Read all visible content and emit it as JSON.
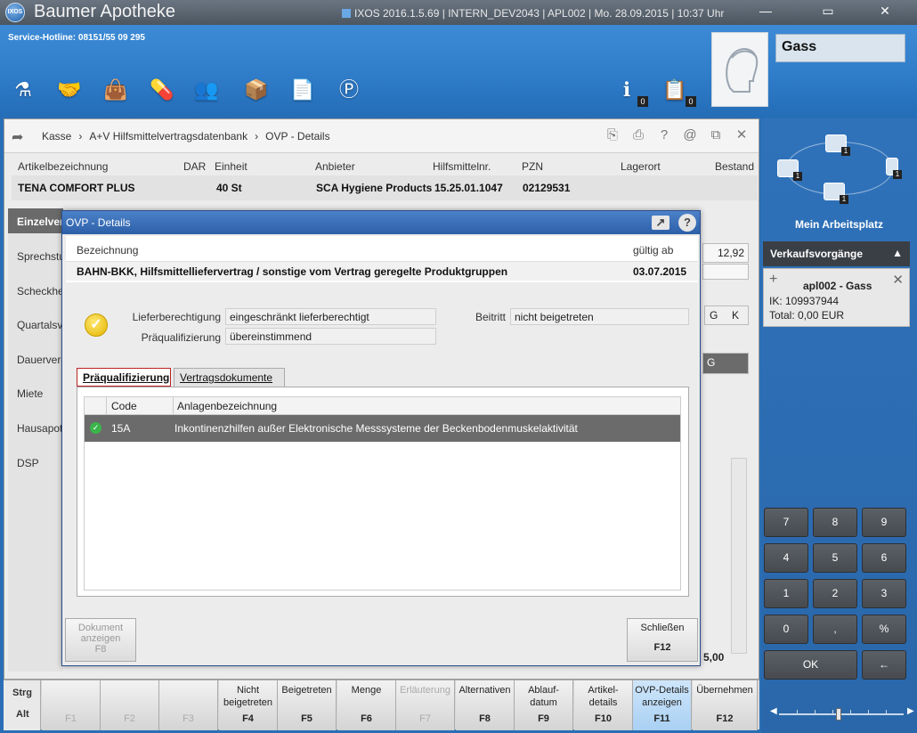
{
  "titlebar": {
    "app_title": "Baumer Apotheke",
    "logo_text": "IXOS",
    "info": "IXOS 2016.1.5.69  |  INTERN_DEV2043  |  APL002  |  Mo. 28.09.2015  |  10:37 Uhr"
  },
  "header": {
    "hotline": "Service-Hotline: 08151/55 09 295",
    "customer_name": "Gass",
    "info_badge": "0",
    "tasks_badge": "0"
  },
  "breadcrumb": {
    "items": [
      "Kasse",
      "A+V Hilfsmittelvertragsdatenbank",
      "OVP - Details"
    ],
    "sep": "›"
  },
  "article": {
    "headers": [
      "Artikelbezeichnung",
      "DAR",
      "Einheit",
      "Anbieter",
      "Hilfsmittelnr.",
      "PZN",
      "Lagerort",
      "Bestand"
    ],
    "name": "TENA COMFORT PLUS",
    "einheit": "40 St",
    "anbieter": "SCA Hygiene Products",
    "hilfsmittelnr": "15.25.01.1047",
    "pzn": "02129531"
  },
  "leftnav": {
    "items": [
      "Einzelverordnung",
      "Sprechstundenbedarf",
      "Scheckheft",
      "Quartalsverordnung",
      "Dauerverordnung",
      "Miete",
      "Hausapotheke",
      "DSP"
    ]
  },
  "background": {
    "price": "12,92",
    "grid_g": "G",
    "grid_k": "K",
    "row_g": "G",
    "total_fragment": "5,00"
  },
  "dialog": {
    "title": "OVP - Details",
    "bezeichnung_label": "Bezeichnung",
    "gueltig_label": "gültig ab",
    "bezeichnung_value": "BAHN-BKK, Hilfsmittelliefervertrag / sonstige vom Vertrag geregelte Produktgruppen",
    "gueltig_value": "03.07.2015",
    "lieferberechtigung_label": "Lieferberechtigung",
    "lieferberechtigung_value": "eingeschränkt lieferberechtigt",
    "praequalifizierung_label": "Präqualifizierung",
    "praequalifizierung_value": "übereinstimmend",
    "beitritt_label": "Beitritt",
    "beitritt_value": "nicht beigetreten",
    "tabs": [
      "Präqualifizierung",
      "Vertragsdokumente"
    ],
    "table": {
      "headers": [
        "Code",
        "Anlagenbezeichnung"
      ],
      "rows": [
        {
          "code": "15A",
          "bezeichnung": "Inkontinenzhilfen außer Elektronische Messsysteme der Beckenbodenmuskelaktivität"
        }
      ]
    },
    "btn_dokument": {
      "label_1": "Dokument",
      "label_2": "anzeigen",
      "key": "F8"
    },
    "btn_schliessen": {
      "label": "Schließen",
      "key": "F12"
    }
  },
  "right": {
    "workplace": "Mein Arbeitsplatz",
    "vk_header": "Verkaufsvorgänge",
    "vk_title": "apl002 - Gass",
    "vk_ik": "IK: 109937944",
    "vk_total": "Total: 0,00 EUR",
    "carousel_badges": [
      "1",
      "1",
      "1",
      "1"
    ],
    "numpad": [
      "7",
      "8",
      "9",
      "4",
      "5",
      "6",
      "1",
      "2",
      "3",
      "0",
      ",",
      "%"
    ],
    "ok": "OK",
    "backspace": "←"
  },
  "fbar": {
    "mod_strg": "Strg",
    "mod_alt": "Alt",
    "keys": [
      {
        "label": "",
        "key": "F1"
      },
      {
        "label": "",
        "key": "F2"
      },
      {
        "label": "",
        "key": "F3"
      },
      {
        "label": "Nicht beigetreten",
        "key": "F4"
      },
      {
        "label": "Beigetreten",
        "key": "F5"
      },
      {
        "label": "Menge",
        "key": "F6"
      },
      {
        "label": "Erläuterung",
        "key": "F7"
      },
      {
        "label": "Alternativen",
        "key": "F8"
      },
      {
        "label": "Ablauf- datum",
        "key": "F9"
      },
      {
        "label": "Artikel- details",
        "key": "F10"
      },
      {
        "label": "OVP-Details anzeigen",
        "key": "F11"
      },
      {
        "label": "Übernehmen",
        "key": "F12"
      }
    ]
  },
  "colors": {
    "header_blue": "#2f7cc9",
    "dialog_title": "#2c5fa8",
    "selected_row": "#6b6b6b",
    "ok_green": "#39b54a",
    "warning_yellow": "#f2c500"
  }
}
